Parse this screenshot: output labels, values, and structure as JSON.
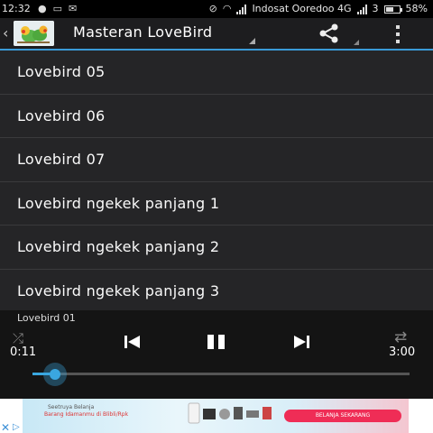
{
  "status_bar": {
    "time": "12:32",
    "carrier": "Indosat Ooredoo 4G",
    "sim_slot": "3",
    "battery": "58%",
    "battery_level": 0.58
  },
  "action_bar": {
    "title": "Masteran LoveBird"
  },
  "playlist": {
    "items": [
      {
        "label": "Lovebird 05"
      },
      {
        "label": "Lovebird 06"
      },
      {
        "label": "Lovebird 07"
      },
      {
        "label": "Lovebird ngekek panjang 1"
      },
      {
        "label": "Lovebird ngekek panjang 2"
      },
      {
        "label": "Lovebird ngekek panjang 3"
      }
    ]
  },
  "player": {
    "now_playing": "Lovebird 01",
    "current_time": "0:11",
    "total_time": "3:00",
    "progress": 0.06,
    "accent": "#3aa7e0"
  },
  "ad": {
    "line1": "Seetruya Belanja",
    "line2": "Barang Idamanmu di Blibli/Rpk",
    "cta": "BELANJA SEKARANG"
  }
}
